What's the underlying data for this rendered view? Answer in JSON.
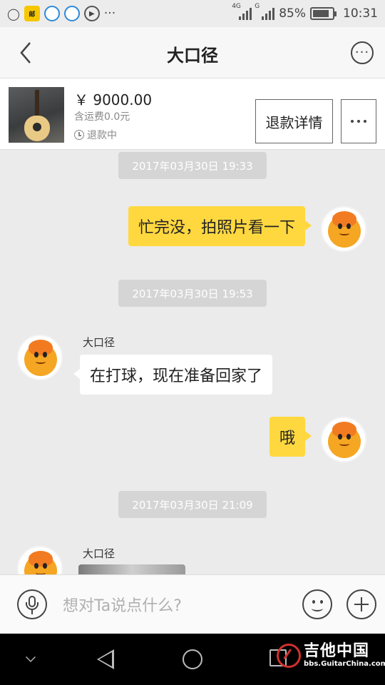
{
  "status_bar": {
    "app_icons": [
      "message-icon",
      "app-icon-1",
      "app-icon-2",
      "app-icon-3",
      "play-icon"
    ],
    "overflow": "···",
    "network_1": "4G",
    "network_2": "G",
    "battery": "85%",
    "battery_level": 0.85,
    "time": "10:31"
  },
  "header": {
    "title": "大口径",
    "back_icon": "chevron-left-icon",
    "more_icon": "more-circle-icon",
    "more_label": "···"
  },
  "product": {
    "price": "￥ 9000.00",
    "shipping": "含运费0.0元",
    "status": "退款中",
    "refund_button": "退款详情",
    "thumbnail": "guitar-photo"
  },
  "chat": {
    "messages": [
      {
        "type": "timestamp",
        "text": "2017年03月30日 19:33"
      },
      {
        "type": "outgoing",
        "text": "忙完没，拍照片看一下"
      },
      {
        "type": "timestamp",
        "text": "2017年03月30日 19:53"
      },
      {
        "type": "incoming",
        "sender": "大口径",
        "text": "在打球，现在准备回家了"
      },
      {
        "type": "outgoing",
        "text": "哦"
      },
      {
        "type": "timestamp",
        "text": "2017年03月30日 21:09"
      },
      {
        "type": "incoming-image",
        "sender": "大口径"
      }
    ]
  },
  "input_bar": {
    "placeholder": "想对Ta说点什么?",
    "voice_icon": "microphone-icon",
    "emoji_icon": "smiley-icon",
    "plus_icon": "plus-icon"
  },
  "nav_bar": {
    "icons": [
      "chevron-down-icon",
      "back-triangle-icon",
      "home-circle-icon",
      "recent-square-icon"
    ]
  },
  "watermark": {
    "chinese": "吉他中国",
    "url": "bbs.GuitarChina.com"
  },
  "colors": {
    "outgoing_bubble": "#ffd840",
    "incoming_bubble": "#ffffff",
    "chat_bg": "#ebebeb",
    "timestamp_bg": "#d5d5d5",
    "watermark_red": "#d0312d"
  }
}
